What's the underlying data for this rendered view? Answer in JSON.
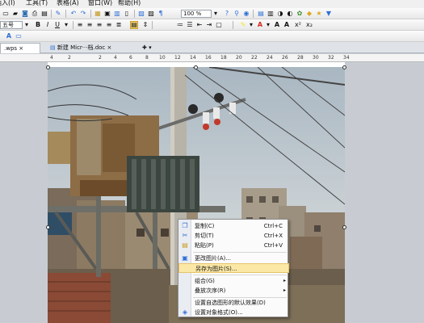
{
  "menu": {
    "items": [
      "插入(I)",
      "工具(T)",
      "表格(A)",
      "窗口(W)",
      "帮助(H)"
    ]
  },
  "toolbar": {
    "zoom_value": "100 %",
    "font_size_value": "五号",
    "bold_label": "B",
    "italic_label": "I",
    "underline_label": "U",
    "font_color_label": "A"
  },
  "tabs": [
    {
      "label": ".wps ×"
    },
    {
      "label": "新建 Micr···档.doc ×"
    }
  ],
  "ruler": {
    "numbers": [
      "4",
      "2",
      "2",
      "4",
      "6",
      "8",
      "10",
      "12",
      "14",
      "16",
      "18",
      "20",
      "22",
      "24",
      "26",
      "28",
      "30",
      "32",
      "34"
    ]
  },
  "context_menu": {
    "items": [
      {
        "label": "复制(C)",
        "shortcut": "Ctrl+C",
        "icon": "copy-icon"
      },
      {
        "label": "剪切(T)",
        "shortcut": "Ctrl+X",
        "icon": "cut-icon"
      },
      {
        "label": "粘贴(P)",
        "shortcut": "Ctrl+V",
        "icon": "paste-icon"
      },
      {
        "label": "更改图片(A)...",
        "shortcut": "",
        "icon": "change-picture-icon"
      },
      {
        "label": "另存为图片(S)...",
        "shortcut": "",
        "icon": ""
      },
      {
        "label": "组合(G)",
        "shortcut": "",
        "icon": ""
      },
      {
        "label": "叠放次序(R)",
        "shortcut": "",
        "icon": ""
      },
      {
        "label": "设置自选图形的默认效果(D)",
        "shortcut": "",
        "icon": ""
      },
      {
        "label": "设置对象格式(O)...",
        "shortcut": "",
        "icon": "format-object-icon"
      }
    ]
  },
  "colors": {
    "highlight": "#fbe8a6",
    "font_color_red": "#d52a1e",
    "highlighter_yellow": "#f5e630"
  }
}
